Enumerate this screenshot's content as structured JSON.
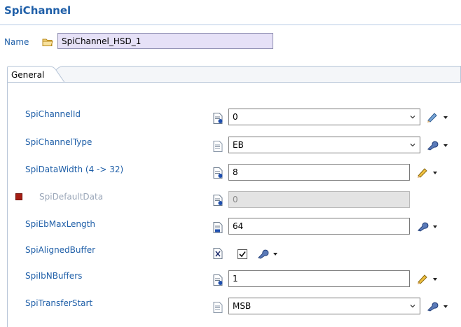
{
  "header": {
    "title": "SpiChannel"
  },
  "name_row": {
    "label": "Name",
    "value": "SpiChannel_HSD_1"
  },
  "tabs": [
    {
      "label": "General"
    }
  ],
  "fields": {
    "channel_id": {
      "label": "SpiChannelId",
      "value": "0"
    },
    "channel_type": {
      "label": "SpiChannelType",
      "value": "EB"
    },
    "data_width": {
      "label": "SpiDataWidth (4 -> 32)",
      "value": "8"
    },
    "default_data": {
      "label": "SpiDefaultData",
      "value": "0"
    },
    "eb_max_length": {
      "label": "SpiEbMaxLength",
      "value": "64"
    },
    "aligned_buffer": {
      "label": "SpiAlignedBuffer",
      "checked": true
    },
    "ib_n_buffers": {
      "label": "SpiIbNBuffers",
      "value": "1"
    },
    "transfer_start": {
      "label": "SpiTransferStart",
      "value": "MSB"
    }
  },
  "colors": {
    "label_blue": "#1f5fa8",
    "name_field_bg": "#e6e1f7",
    "default_marker": "#a51e14"
  }
}
